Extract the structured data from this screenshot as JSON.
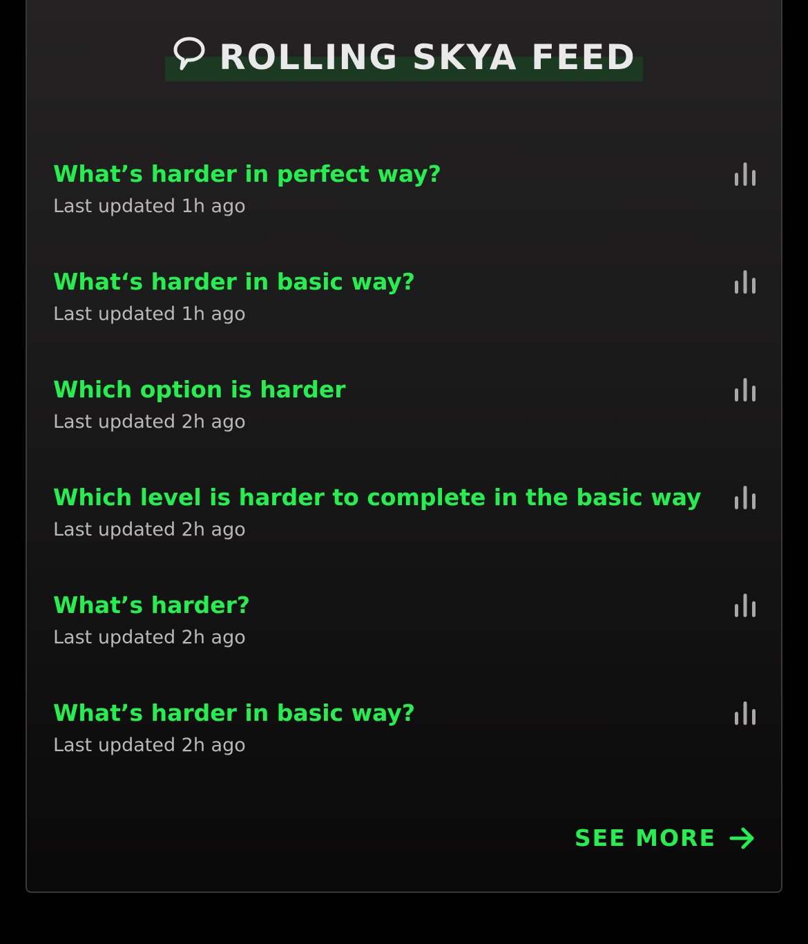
{
  "colors": {
    "accent": "#23f04f",
    "title_text": "#e9e9e9",
    "meta_text": "#b9b9b9",
    "icon": "#a8a8a8",
    "header_highlight": "#1c3a22",
    "panel_border": "#3a3a3a",
    "page_background": "#000000"
  },
  "header": {
    "icon": "speech-bubble-icon",
    "title": "ROLLING SKYA FEED"
  },
  "feed": {
    "items": [
      {
        "title": "What’s harder in perfect way?",
        "meta": "Last updated 1h ago",
        "icon": "bar-chart-icon"
      },
      {
        "title": "What‘s harder in basic way?",
        "meta": "Last updated 1h ago",
        "icon": "bar-chart-icon"
      },
      {
        "title": "Which option is harder",
        "meta": "Last updated 2h ago",
        "icon": "bar-chart-icon"
      },
      {
        "title": "Which level is harder to complete in the basic way",
        "meta": "Last updated 2h ago",
        "icon": "bar-chart-icon"
      },
      {
        "title": "What’s harder?",
        "meta": "Last updated 2h ago",
        "icon": "bar-chart-icon"
      },
      {
        "title": "What’s harder in basic way?",
        "meta": "Last updated 2h ago",
        "icon": "bar-chart-icon"
      }
    ]
  },
  "footer": {
    "see_more_label": "SEE MORE",
    "arrow_icon": "arrow-right-icon"
  }
}
